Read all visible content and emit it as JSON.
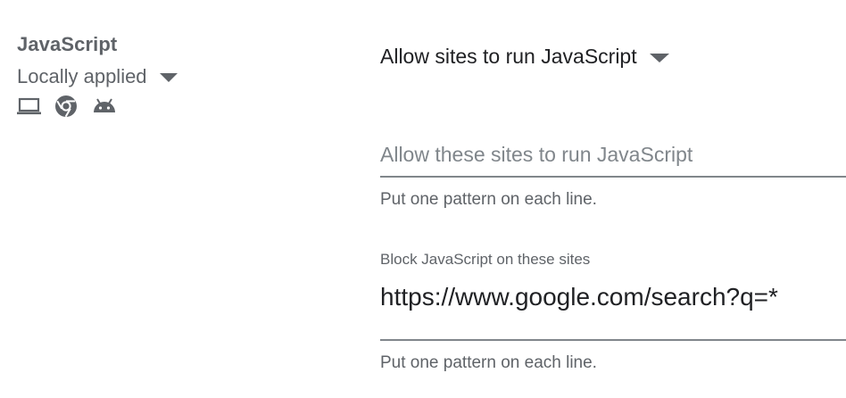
{
  "policy": {
    "title": "JavaScript",
    "scope_value": "Locally applied",
    "platform_icons": [
      "laptop-icon",
      "chrome-icon",
      "android-icon"
    ]
  },
  "setting": {
    "selected_value": "Allow sites to run JavaScript"
  },
  "allow_field": {
    "placeholder": "Allow these sites to run JavaScript",
    "value": "",
    "hint": "Put one pattern on each line."
  },
  "block_field": {
    "label": "Block JavaScript on these sites",
    "value": "https://www.google.com/search?q=*",
    "hint": "Put one pattern on each line."
  },
  "colors": {
    "primary_text": "#202124",
    "secondary_text": "#5f6368",
    "underline": "#80868b"
  }
}
